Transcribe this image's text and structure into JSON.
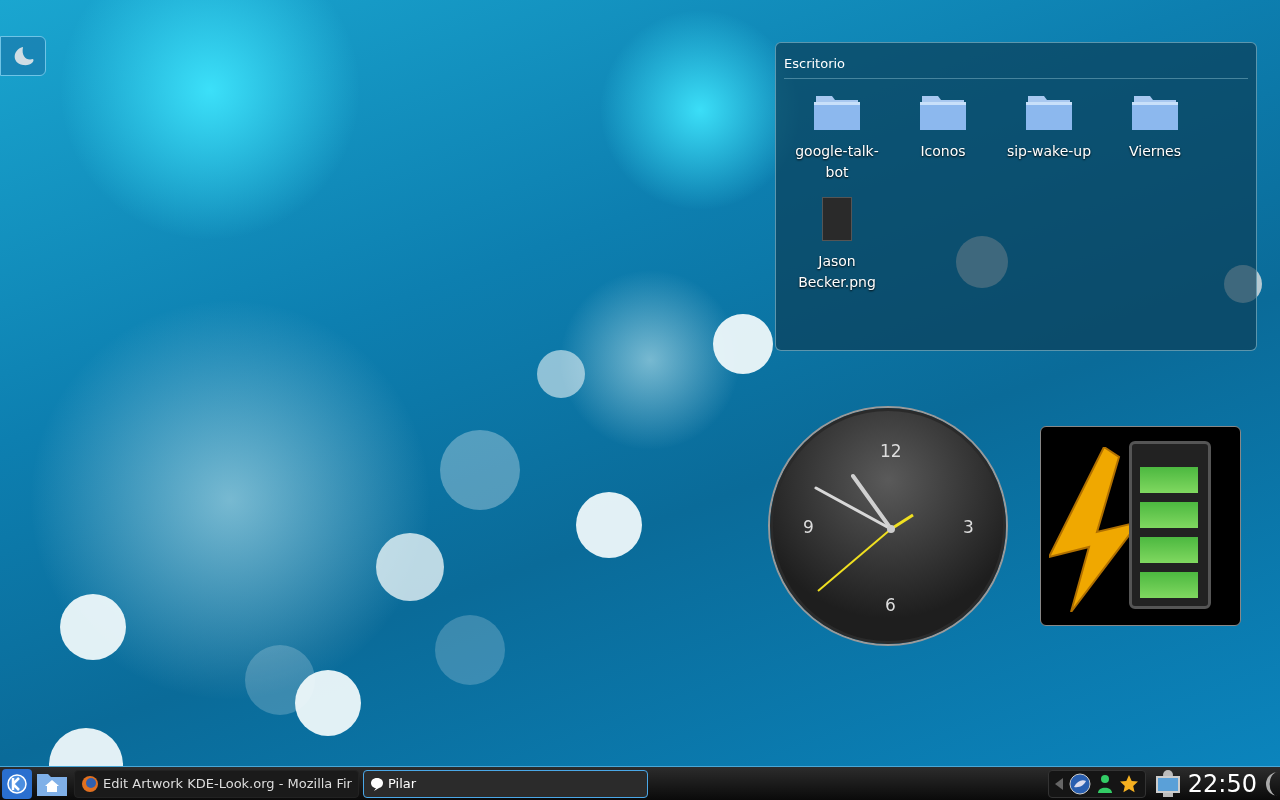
{
  "folder_view": {
    "title": "Escritorio",
    "items": [
      {
        "kind": "folder",
        "label": "google-talk-bot"
      },
      {
        "kind": "folder",
        "label": "Iconos"
      },
      {
        "kind": "folder",
        "label": "sip-wake-up"
      },
      {
        "kind": "folder",
        "label": "Viernes"
      },
      {
        "kind": "image",
        "label": "Jason Becker.png"
      }
    ]
  },
  "analog_clock": {
    "numerals": [
      "12",
      "3",
      "6",
      "9"
    ]
  },
  "battery": {
    "level": 1
  },
  "taskbar": {
    "tasks": [
      {
        "label": "Edit Artwork KDE-Look.org - Mozilla Fir",
        "kind": "browser",
        "selected": false
      },
      {
        "label": "Pilar",
        "kind": "chat",
        "selected": true
      }
    ],
    "clock": "22:50"
  }
}
